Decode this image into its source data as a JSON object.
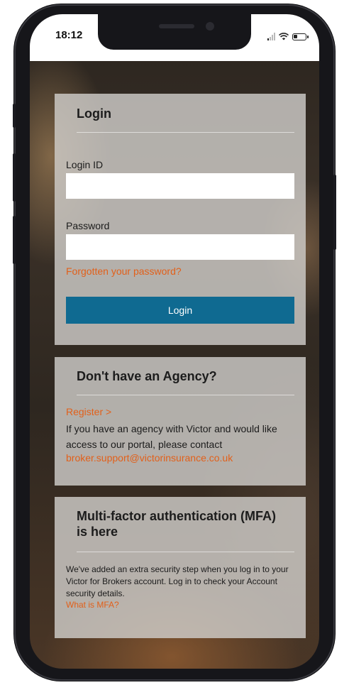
{
  "status_bar": {
    "time": "18:12",
    "icons": [
      "signal-icon",
      "wifi-icon",
      "battery-icon"
    ]
  },
  "login": {
    "title": "Login",
    "login_id_label": "Login ID",
    "login_id_value": "",
    "password_label": "Password",
    "password_value": "",
    "forgot_link": "Forgotten your password?",
    "button_label": "Login"
  },
  "agency": {
    "title": "Don't have an Agency?",
    "register_link": "Register >",
    "text": "If you have an agency with Victor and would like access to our portal, please contact",
    "email": "broker.support@victorinsurance.co.uk"
  },
  "mfa": {
    "title": "Multi-factor authentication (MFA) is here",
    "text": "We've added an extra security step when you log in to your Victor for Brokers account. Log in to check your Account security details.",
    "link": "What is MFA?"
  },
  "colors": {
    "accent_link": "#e2601a",
    "button": "#0f6a91",
    "card": "#d0cdc9"
  }
}
